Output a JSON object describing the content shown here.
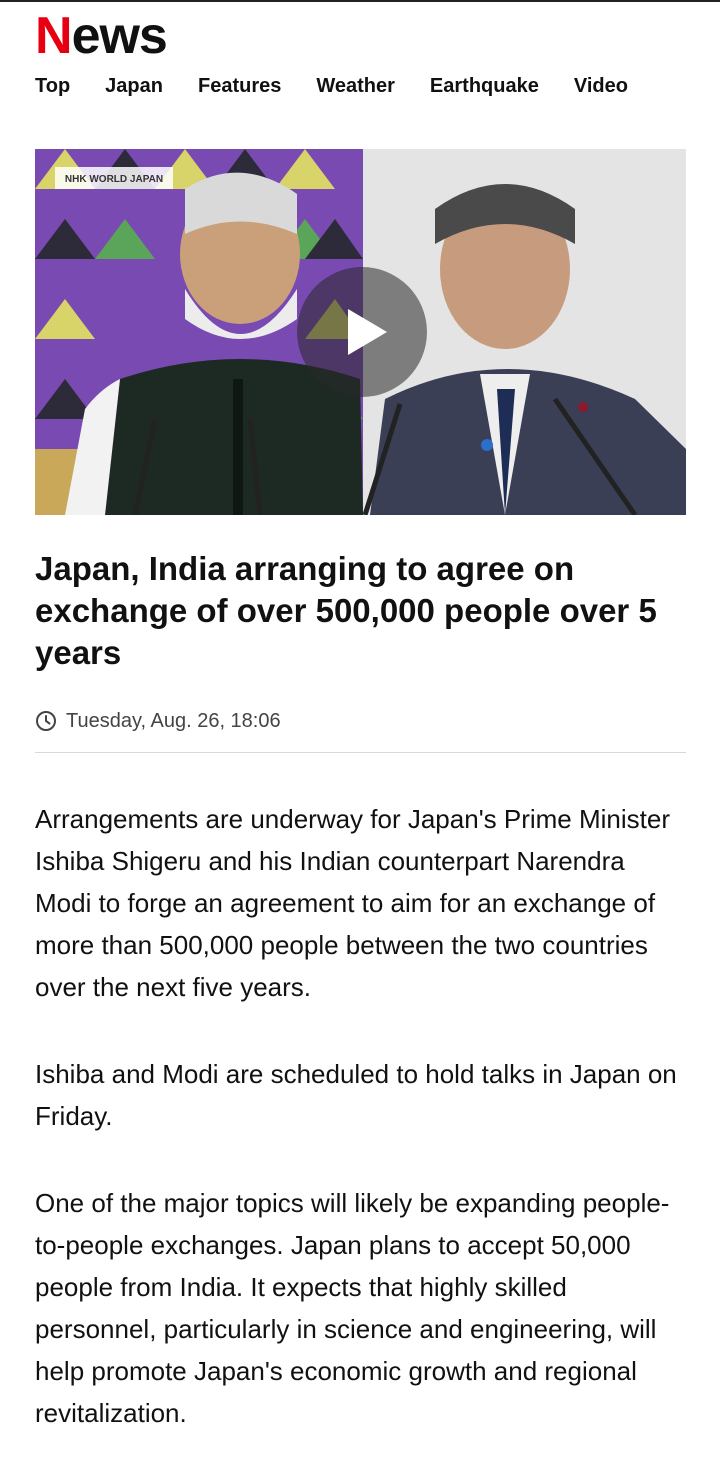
{
  "header": {
    "logo_initial": "N",
    "logo_rest": "ews",
    "nav": [
      "Top",
      "Japan",
      "Features",
      "Weather",
      "Earthquake",
      "Video"
    ]
  },
  "video": {
    "watermark": "NHK WORLD JAPAN",
    "play_icon": "play-icon"
  },
  "article": {
    "headline": "Japan, India arranging to agree on exchange of over 500,000 people over 5 years",
    "date": "Tuesday, Aug. 26, 18:06",
    "paragraphs": [
      "Arrangements are underway for Japan's Prime Minister Ishiba Shigeru and his Indian counterpart Narendra Modi to forge an agreement to aim for an exchange of more than 500,000 people between the two countries over the next five years.",
      "Ishiba and Modi are scheduled to hold talks in Japan on Friday.",
      "One of the major topics will likely be expanding people-to-people exchanges. Japan plans to accept 50,000 people from India. It expects that highly skilled personnel, particularly in science and engineering, will help promote Japan's economic growth and regional revitalization."
    ]
  },
  "colors": {
    "brand_red": "#e60012",
    "text": "#111111",
    "muted": "#444444",
    "divider": "#d9d9d9"
  }
}
